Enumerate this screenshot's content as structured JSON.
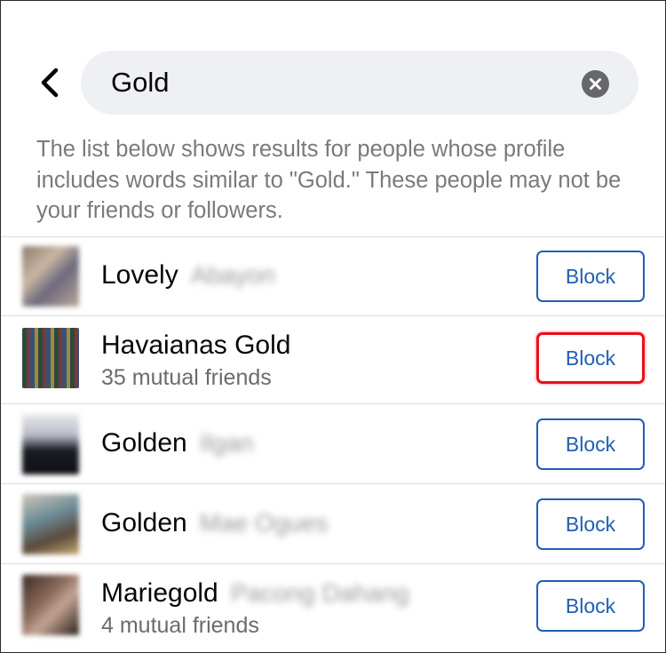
{
  "search": {
    "value": "Gold",
    "back_icon": "chevron-left-icon",
    "clear_icon": "close-circle-icon"
  },
  "description": "The list below shows results for people whose profile includes words similar to \"Gold.\" These people may not be your friends or followers.",
  "results": [
    {
      "name": "Lovely",
      "name_suffix": "Abayon",
      "mutual": "",
      "button": "Block"
    },
    {
      "name": "Havaianas Gold",
      "name_suffix": "",
      "mutual": "35 mutual friends",
      "button": "Block"
    },
    {
      "name": "Golden",
      "name_suffix": "Ilgan",
      "mutual": "",
      "button": "Block"
    },
    {
      "name": "Golden",
      "name_suffix": "Mae Ogues",
      "mutual": "",
      "button": "Block"
    },
    {
      "name": "Mariegold",
      "name_suffix": "Pacong Dahang",
      "mutual": "4 mutual friends",
      "button": "Block"
    }
  ],
  "colors": {
    "accent": "#1f5fb3",
    "highlight": "#e8101a",
    "search_bg": "#eef0f3"
  }
}
